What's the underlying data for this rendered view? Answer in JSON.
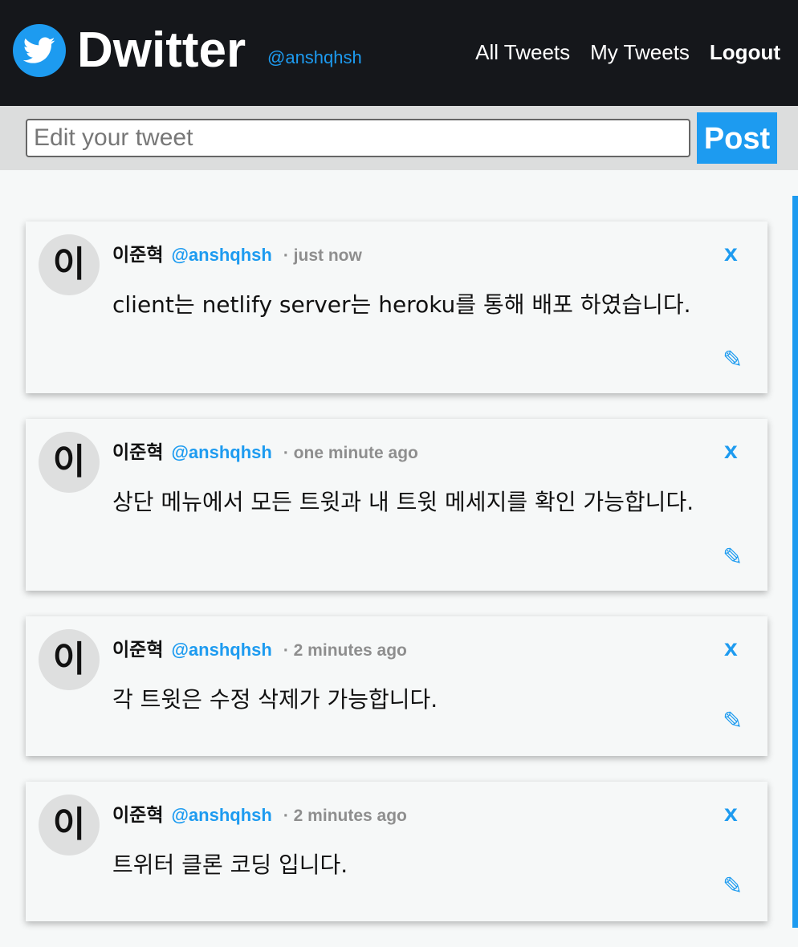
{
  "header": {
    "brand": "Dwitter",
    "handle": "@anshqhsh",
    "nav": {
      "all_tweets": "All Tweets",
      "my_tweets": "My Tweets",
      "logout": "Logout"
    },
    "logo_icon": "twitter-bird-icon"
  },
  "compose": {
    "placeholder": "Edit your tweet",
    "value": "",
    "post_label": "Post"
  },
  "tweets": [
    {
      "avatar": "이",
      "name": "이준혁",
      "handle": "@anshqhsh",
      "time": "· just now",
      "text": "client는 netlify server는 heroku를 통해 배포 하였습니다.",
      "delete_label": "x",
      "edit_label": "✎"
    },
    {
      "avatar": "이",
      "name": "이준혁",
      "handle": "@anshqhsh",
      "time": "· one minute ago",
      "text": "상단 메뉴에서 모든 트윗과 내 트윗 메세지를 확인 가능합니다.",
      "delete_label": "x",
      "edit_label": "✎"
    },
    {
      "avatar": "이",
      "name": "이준혁",
      "handle": "@anshqhsh",
      "time": "· 2 minutes ago",
      "text": "각 트윗은 수정 삭제가 가능합니다.",
      "delete_label": "x",
      "edit_label": "✎"
    },
    {
      "avatar": "이",
      "name": "이준혁",
      "handle": "@anshqhsh",
      "time": "· 2 minutes ago",
      "text": "트위터 클론 코딩 입니다.",
      "delete_label": "x",
      "edit_label": "✎"
    }
  ],
  "colors": {
    "accent": "#1d9bf0",
    "header_bg": "#15171b",
    "compose_bg": "#dcdddd",
    "page_bg": "#f6f8f8"
  }
}
